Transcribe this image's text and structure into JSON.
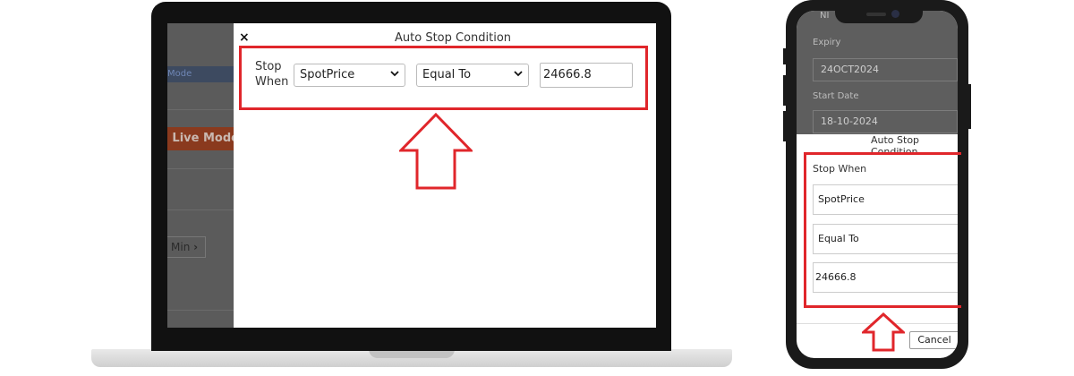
{
  "laptop": {
    "background_app": {
      "mode_label": "Mode",
      "live_mode_label": "> Live Mode",
      "min_button_label": "Min"
    },
    "modal": {
      "close_icon": "×",
      "title": "Auto Stop Condition",
      "stop_when_label_line1": "Stop",
      "stop_when_label_line2": "When",
      "field_select_value": "SpotPrice",
      "operator_select_value": "Equal To",
      "value_input": "24666.8"
    }
  },
  "phone": {
    "background_app": {
      "top_label_partial": "NI",
      "expiry_label": "Expiry",
      "expiry_value": "24OCT2024",
      "start_date_label": "Start Date",
      "start_date_value": "18-10-2024"
    },
    "modal": {
      "title": "Auto Stop Condition",
      "stop_when_label": "Stop When",
      "field_value": "SpotPrice",
      "operator_value": "Equal To",
      "value_input": "24666.8",
      "cancel_label": "Cancel"
    }
  },
  "annotation": {
    "highlight_color": "#e0262b",
    "arrow_icon": "up-arrow-outline"
  }
}
